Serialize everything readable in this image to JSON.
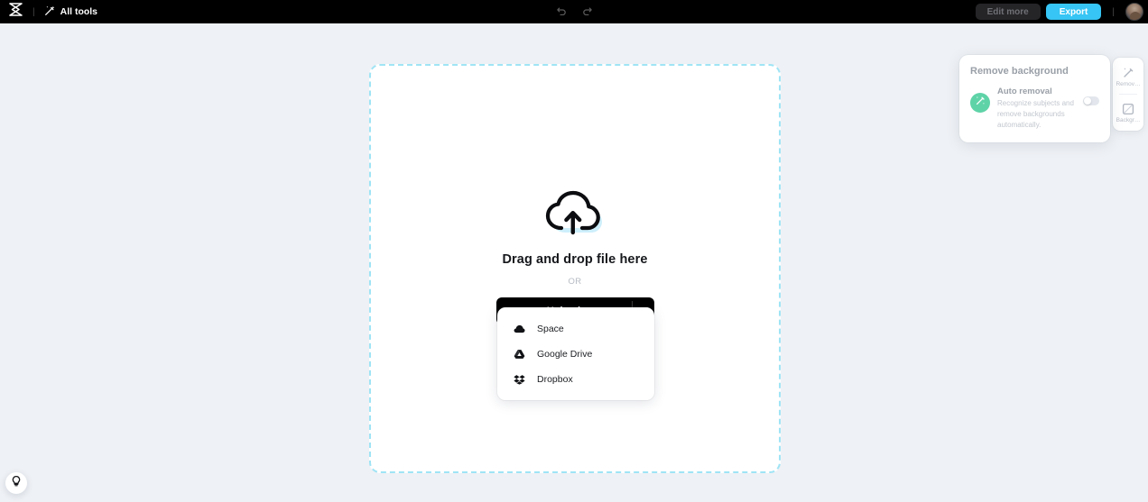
{
  "topbar": {
    "logo_icon": "capcut-logo-icon",
    "separator": "|",
    "all_tools_label": "All tools",
    "all_tools_icon": "magic-wand-icon",
    "undo_icon": "undo-arrow-icon",
    "redo_icon": "redo-arrow-icon",
    "edit_more_label": "Edit more",
    "export_label": "Export",
    "export_color": "#36c5f4",
    "avatar_name": "user-avatar"
  },
  "dropzone": {
    "upload_cloud_icon": "cloud-upload-icon",
    "title": "Drag and drop file here",
    "or_label": "OR",
    "upload_label": "Upload",
    "more_label": "•••",
    "border_color": "#9fe4f5"
  },
  "source_menu": {
    "items": [
      {
        "label": "Space",
        "icon": "space-cloud-icon"
      },
      {
        "label": "Google Drive",
        "icon": "google-drive-icon"
      },
      {
        "label": "Dropbox",
        "icon": "dropbox-icon"
      }
    ]
  },
  "right_panel": {
    "title": "Remove background",
    "auto_removal": {
      "badge_icon": "magic-wand-icon",
      "badge_color": "#5fd3a8",
      "title": "Auto removal",
      "description": "Recognize subjects and remove backgrounds automatically.",
      "toggle_state": "off"
    }
  },
  "right_rail": {
    "items": [
      {
        "label": "Remov…",
        "icon": "magic-wand-icon"
      },
      {
        "label": "Backgr…",
        "icon": "image-frame-icon"
      }
    ]
  },
  "help": {
    "icon": "lightbulb-icon"
  },
  "page": {
    "background_color": "#eef1f5"
  }
}
